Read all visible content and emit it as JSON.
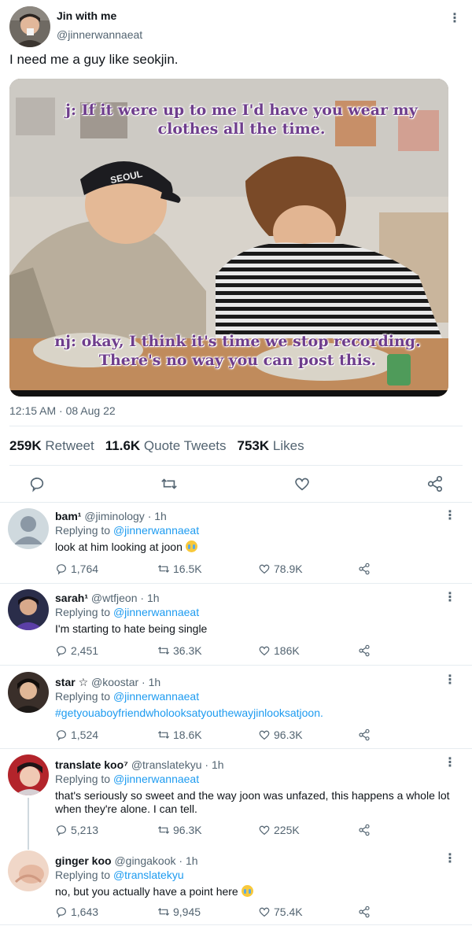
{
  "main_tweet": {
    "author_name": "Jin with me",
    "author_handle": "@jinnerwannaeat",
    "text": "I need me a guy like seokjin.",
    "media": {
      "caption_top_line1": "j: If it were up to me I'd have you wear my",
      "caption_top_line2": "clothes all the time.",
      "caption_bottom_line1": "nj: okay, I think it's time we stop recording.",
      "caption_bottom_line2": "There's no way you can post this.",
      "cap_text": "SEOUL"
    },
    "timestamp": "12:15 AM · 08 Aug 22",
    "stats": {
      "retweets_count": "259K",
      "retweets_label": "Retweet",
      "quotes_count": "11.6K",
      "quotes_label": "Quote Tweets",
      "likes_count": "753K",
      "likes_label": "Likes"
    },
    "icons": [
      "reply-icon",
      "retweet-icon",
      "like-icon",
      "share-icon"
    ]
  },
  "replies": [
    {
      "name": "bam¹",
      "handle": "@jiminology",
      "time": "· 1h",
      "replying_label": "Replying to",
      "replying_to": "@jinnerwannaeat",
      "text": "look at him looking at joon",
      "emoji": "crying-face",
      "replies": "1,764",
      "retweets": "16.5K",
      "likes": "78.9K"
    },
    {
      "name": "sarah¹",
      "handle": "@wtfjeon",
      "time": "· 1h",
      "replying_label": "Replying to",
      "replying_to": "@jinnerwannaeat",
      "text": "I'm starting to hate being single",
      "replies": "2,451",
      "retweets": "36.3K",
      "likes": "186K"
    },
    {
      "name": "star ☆",
      "handle": "@koostar",
      "time": "· 1h",
      "replying_label": "Replying to",
      "replying_to": "@jinnerwannaeat",
      "text": "#getyouaboyfriendwholooksatyouthewayjinlooksatjoon.",
      "replies": "1,524",
      "retweets": "18.6K",
      "likes": "96.3K"
    },
    {
      "name": "translate koo⁷",
      "handle": "@translatekyu",
      "time": "· 1h",
      "replying_label": "Replying to",
      "replying_to": "@jinnerwannaeat",
      "text": "that's seriously so sweet and the way joon was unfazed, this happens a whole lot when they're alone. I can tell.",
      "replies": "5,213",
      "retweets": "96.3K",
      "likes": "225K"
    },
    {
      "name": "ginger koo",
      "handle": "@gingakook",
      "time": "· 1h",
      "replying_label": "Replying to",
      "replying_to": "@translatekyu",
      "text": "no, but you actually have a point here",
      "emoji": "crying-face",
      "replies": "1,643",
      "retweets": "9,945",
      "likes": "75.4K"
    }
  ],
  "colors": {
    "text_primary": "#0f1419",
    "text_secondary": "#536471",
    "link": "#1d9bf0",
    "divider": "#e6ecf0",
    "caption": "#6e3d8c"
  }
}
